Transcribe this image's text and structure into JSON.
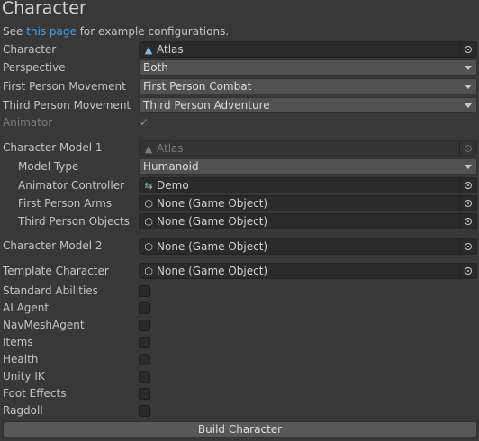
{
  "title": "Character",
  "note": {
    "prefix": "See ",
    "link": "this page",
    "suffix": " for example configurations."
  },
  "rows": {
    "character": {
      "label": "Character",
      "value": "Atlas",
      "icon": "person-icon"
    },
    "perspective": {
      "label": "Perspective",
      "value": "Both"
    },
    "first_person_movement": {
      "label": "First Person Movement",
      "value": "First Person Combat"
    },
    "third_person_movement": {
      "label": "Third Person Movement",
      "value": "Third Person Adventure"
    },
    "animator": {
      "label": "Animator",
      "checked": true
    },
    "character_model_1": {
      "label": "Character Model 1",
      "value": "Atlas",
      "icon": "person-icon"
    },
    "model_type": {
      "label": "Model Type",
      "value": "Humanoid"
    },
    "animator_controller": {
      "label": "Animator Controller",
      "value": "Demo",
      "icon": "animator-controller-icon"
    },
    "first_person_arms": {
      "label": "First Person Arms",
      "value": "None (Game Object)",
      "icon": "cube-icon"
    },
    "third_person_objects": {
      "label": "Third Person Objects",
      "value": "None (Game Object)",
      "icon": "cube-icon"
    },
    "character_model_2": {
      "label": "Character Model 2",
      "value": "None (Game Object)",
      "icon": "cube-icon"
    },
    "template_character": {
      "label": "Template Character",
      "value": "None (Game Object)",
      "icon": "cube-icon"
    }
  },
  "toggles": [
    {
      "label": "Standard Abilities",
      "checked": false
    },
    {
      "label": "AI Agent",
      "checked": false
    },
    {
      "label": "NavMeshAgent",
      "checked": false
    },
    {
      "label": "Items",
      "checked": false
    },
    {
      "label": "Health",
      "checked": false
    },
    {
      "label": "Unity IK",
      "checked": false
    },
    {
      "label": "Foot Effects",
      "checked": false
    },
    {
      "label": "Ragdoll",
      "checked": false
    }
  ],
  "button": {
    "label": "Build Character"
  }
}
